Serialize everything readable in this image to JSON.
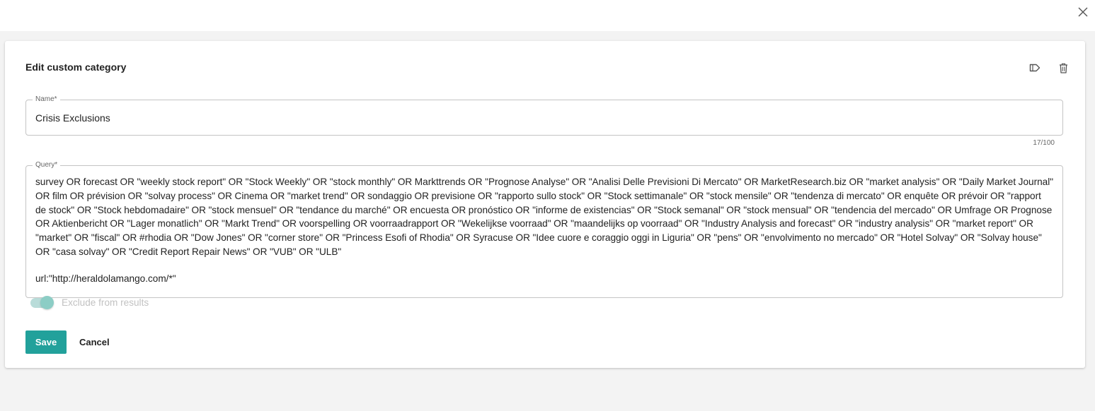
{
  "dialog": {
    "close_icon": "close-icon"
  },
  "card": {
    "title": "Edit custom category",
    "icons": [
      "label-icon",
      "trash-icon"
    ]
  },
  "name_field": {
    "label": "Name*",
    "value": "Crisis Exclusions",
    "counter": "17/100"
  },
  "query_field": {
    "label": "Query*",
    "value": "survey OR forecast OR \"weekly stock report\" OR \"Stock Weekly\" OR \"stock monthly\" OR Markttrends OR \"Prognose Analyse\" OR \"Analisi Delle Previsioni Di Mercato\" OR MarketResearch.biz OR \"market analysis\" OR \"Daily Market Journal\" OR film OR prévision OR \"solvay process\" OR Cinema OR \"market trend\" OR sondaggio OR previsione OR \"rapporto sullo stock\" OR \"Stock settimanale\" OR \"stock mensile\" OR \"tendenza di mercato\" OR enquête OR prévoir OR \"rapport de stock\" OR \"Stock hebdomadaire\" OR \"stock mensuel\" OR \"tendance du marché\" OR encuesta OR pronóstico OR \"informe de existencias\" OR \"Stock semanal\" OR \"stock mensual\" OR \"tendencia del mercado\" OR Umfrage OR Prognose OR Aktienbericht OR \"Lager monatlich\" OR \"Markt Trend\" OR voorspelling OR voorraadrapport OR \"Wekelijkse voorraad\" OR \"maandelijks op voorraad\" OR \"Industry Analysis and forecast\" OR \"industry analysis\" OR \"market report\" OR \"market\" OR \"fiscal\" OR #rhodia OR \"Dow Jones\" OR \"corner store\" OR \"Princess Esofi of Rhodia\" OR Syracuse OR \"Idee cuore e coraggio oggi in Liguria\" OR \"pens\" OR \"envolvimento no mercado\" OR \"Hotel Solvay\" OR \"Solvay house\" OR \"casa solvay\" OR \"Credit Report Repair News\" OR \"VUB\" OR \"ULB\"",
    "url_line": "url:\"http://heraldolamango.com/*\""
  },
  "toggle": {
    "label": "Exclude from results",
    "checked": true,
    "disabled": true
  },
  "actions": {
    "save_label": "Save",
    "cancel_label": "Cancel"
  },
  "colors": {
    "accent": "#22a19b",
    "background": "#f3f3f3"
  }
}
